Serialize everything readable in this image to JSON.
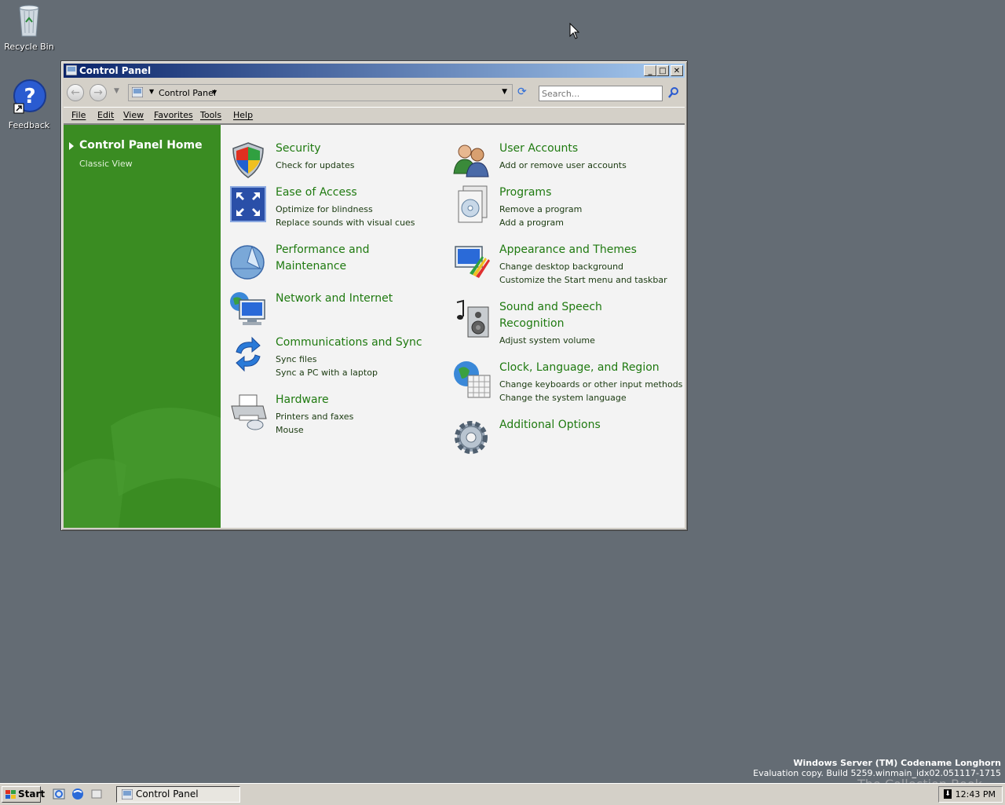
{
  "desktop": {
    "icons": [
      {
        "label": "Recycle Bin",
        "icon": "recycle-bin-icon"
      },
      {
        "label": "Feedback",
        "icon": "feedback-icon"
      }
    ],
    "watermark": {
      "line1": "Windows Server (TM) Codename Longhorn",
      "line2": "Evaluation copy. Build 5259.winmain_idx02.051117-1715"
    },
    "overlay_text": "The Collection Book"
  },
  "window": {
    "title": "Control Panel",
    "controls": {
      "minimize": "_",
      "maximize": "□",
      "close": "✕"
    },
    "address": {
      "crumb": "Control Panel",
      "search_placeholder": "Search..."
    },
    "menu": [
      "File",
      "Edit",
      "View",
      "Favorites",
      "Tools",
      "Help"
    ],
    "left_pane": {
      "home": "Control Panel Home",
      "classic": "Classic View"
    },
    "categories": [
      {
        "title": "Security",
        "links": [
          "Check for updates"
        ],
        "icon": "security-shield-icon"
      },
      {
        "title": "Ease of Access",
        "links": [
          "Optimize for blindness",
          "Replace sounds with visual cues"
        ],
        "icon": "ease-of-access-icon"
      },
      {
        "title_lines": [
          "Performance and",
          "Maintenance"
        ],
        "links": [],
        "icon": "performance-icon"
      },
      {
        "title": "Network and Internet",
        "links": [],
        "icon": "network-icon"
      },
      {
        "title": "Communications and Sync",
        "links": [
          "Sync files",
          "Sync a PC with a laptop"
        ],
        "icon": "sync-icon"
      },
      {
        "title": "Hardware",
        "links": [
          "Printers and faxes",
          "Mouse"
        ],
        "icon": "printer-icon"
      },
      {
        "title": "User Accounts",
        "links": [
          "Add or remove user accounts"
        ],
        "icon": "users-icon"
      },
      {
        "title": "Programs",
        "links": [
          "Remove a program",
          "Add a program"
        ],
        "icon": "programs-icon"
      },
      {
        "title": "Appearance and Themes",
        "links": [
          "Change desktop background",
          "Customize the Start menu and taskbar"
        ],
        "icon": "appearance-icon"
      },
      {
        "title_lines": [
          "Sound and Speech",
          "Recognition"
        ],
        "links": [
          "Adjust system volume"
        ],
        "icon": "sound-icon"
      },
      {
        "title": "Clock, Language, and Region",
        "links": [
          "Change keyboards or other input methods",
          "Change the system language"
        ],
        "icon": "clock-language-icon"
      },
      {
        "title": "Additional Options",
        "links": [],
        "icon": "gear-icon"
      }
    ]
  },
  "taskbar": {
    "start": "Start",
    "task": "Control Panel",
    "clock": "12:43 PM"
  },
  "colors": {
    "desktop": "#646c74",
    "accent_green": "#3a8c22",
    "link_green": "#1f7a10",
    "title_gradient_start": "#0a246a"
  }
}
